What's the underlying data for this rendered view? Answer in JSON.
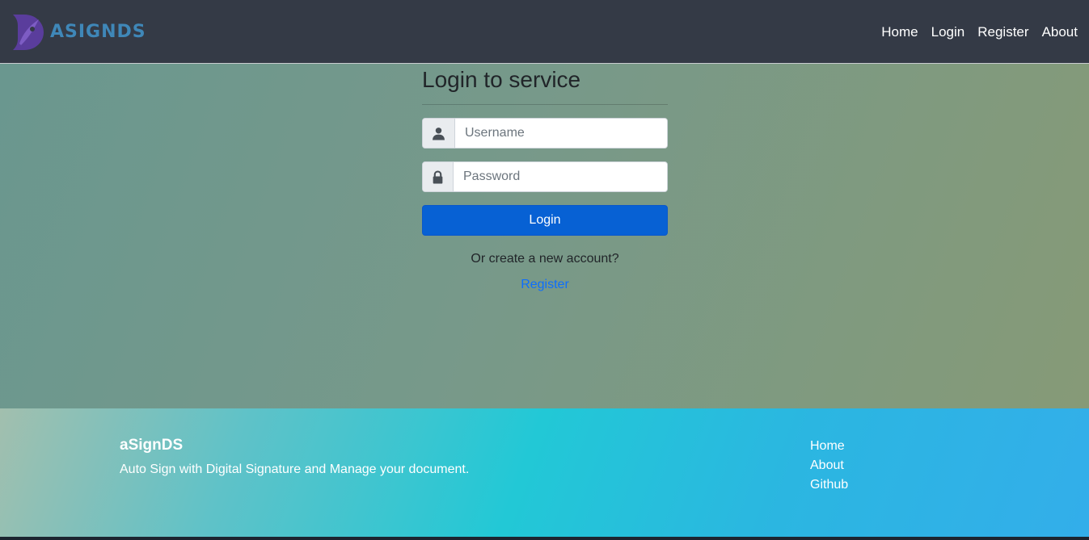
{
  "navbar": {
    "brand_text": "ASIGNDS",
    "links": [
      "Home",
      "Login",
      "Register",
      "About"
    ]
  },
  "login": {
    "title": "Login to service",
    "username_placeholder": "Username",
    "password_placeholder": "Password",
    "submit_label": "Login",
    "alt_prompt": "Or create a new account?",
    "register_link": "Register"
  },
  "footer": {
    "brand": "aSignDS",
    "description": "Auto Sign with Digital Signature and Manage your document.",
    "links": [
      "Home",
      "About",
      "Github"
    ]
  },
  "icons": {
    "username": "user-icon",
    "password": "lock-icon",
    "logo": "quill-logo-icon"
  },
  "colors": {
    "navbar_bg": "#343a46",
    "brand_text": "#3f87b8",
    "logo": "#5a3d9c",
    "primary_button": "#0761d4",
    "link": "#0d6efd"
  }
}
